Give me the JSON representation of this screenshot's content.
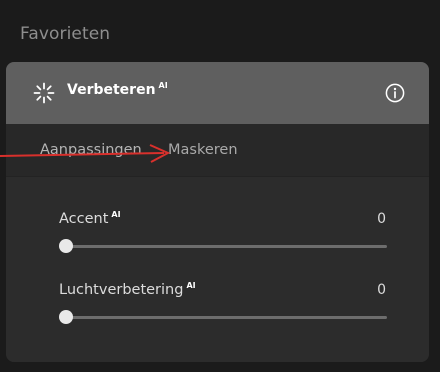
{
  "favorites": {
    "title": "Favorieten"
  },
  "panel": {
    "title": "Verbeteren",
    "ai_badge": "AI",
    "icons": {
      "enhance": "sparkle-icon",
      "info": "info-icon"
    }
  },
  "tabs": [
    {
      "label": "Aanpassingen",
      "active": true
    },
    {
      "label": "Maskeren",
      "active": false
    }
  ],
  "sliders": [
    {
      "label": "Accent",
      "ai_badge": "AI",
      "value": "0",
      "fraction": 0
    },
    {
      "label": "Luchtverbetering",
      "ai_badge": "AI",
      "value": "0",
      "fraction": 0
    }
  ],
  "annotation": {
    "color": "#d9302c",
    "target": "Maskeren"
  },
  "colors": {
    "background": "#1b1b1b",
    "header": "#5f5f5f",
    "panel": "#2b2b2b",
    "track": "#6d6d6d",
    "thumb": "#e9e9e9"
  }
}
